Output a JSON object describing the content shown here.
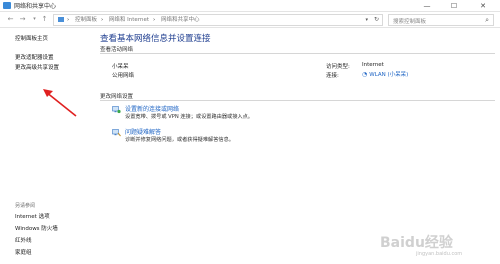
{
  "window": {
    "title": "网络和共享中心",
    "minimize_glyph": "—",
    "maximize_glyph": "☐",
    "close_glyph": "✕",
    "icons": {
      "app": "network-center-icon"
    }
  },
  "addressbar": {
    "back_glyph": "←",
    "forward_glyph": "→",
    "recent_glyph": "▾",
    "up_glyph": "↑",
    "breadcrumbs": [
      "控制面板",
      "网络和 Internet",
      "网络和共享中心"
    ],
    "separator": "›",
    "dropdown_glyph": "▾",
    "refresh_glyph": "↻",
    "search_placeholder": "搜索控制面板",
    "search_glyph": "⌕"
  },
  "sidebar": {
    "home": "控制面板主页",
    "links": [
      "更改适配器设置",
      "更改高级共享设置"
    ],
    "see_also_label": "另请参阅",
    "see_also": [
      "Internet 选项",
      "Windows 防火墙",
      "红外线",
      "家庭组"
    ]
  },
  "main": {
    "heading": "查看基本网络信息并设置连接",
    "active_networks_label": "查看活动网络",
    "network": {
      "name": "小呆呆",
      "type": "公用网络",
      "access_label": "访问类型:",
      "access_value": "Internet",
      "connection_label": "连接:",
      "connection_value": "WLAN (小呆呆)"
    },
    "change_settings_label": "更改网络设置",
    "tasks": [
      {
        "title": "设置新的连接或网络",
        "desc": "设置宽带、拨号或 VPN 连接；或设置路由器或接入点。",
        "icon": "new-connection-icon"
      },
      {
        "title": "问题疑难解答",
        "desc": "诊断并修复网络问题，或者获得疑难解答信息。",
        "icon": "troubleshoot-icon"
      }
    ]
  },
  "annotation": {
    "color": "#e02020"
  },
  "watermark": {
    "logo": "Baidu经验",
    "sub": "jingyan.baidu.com"
  },
  "colors": {
    "link": "#1c63c4",
    "heading": "#1e3d8f",
    "accent": "#3a8ad8"
  }
}
